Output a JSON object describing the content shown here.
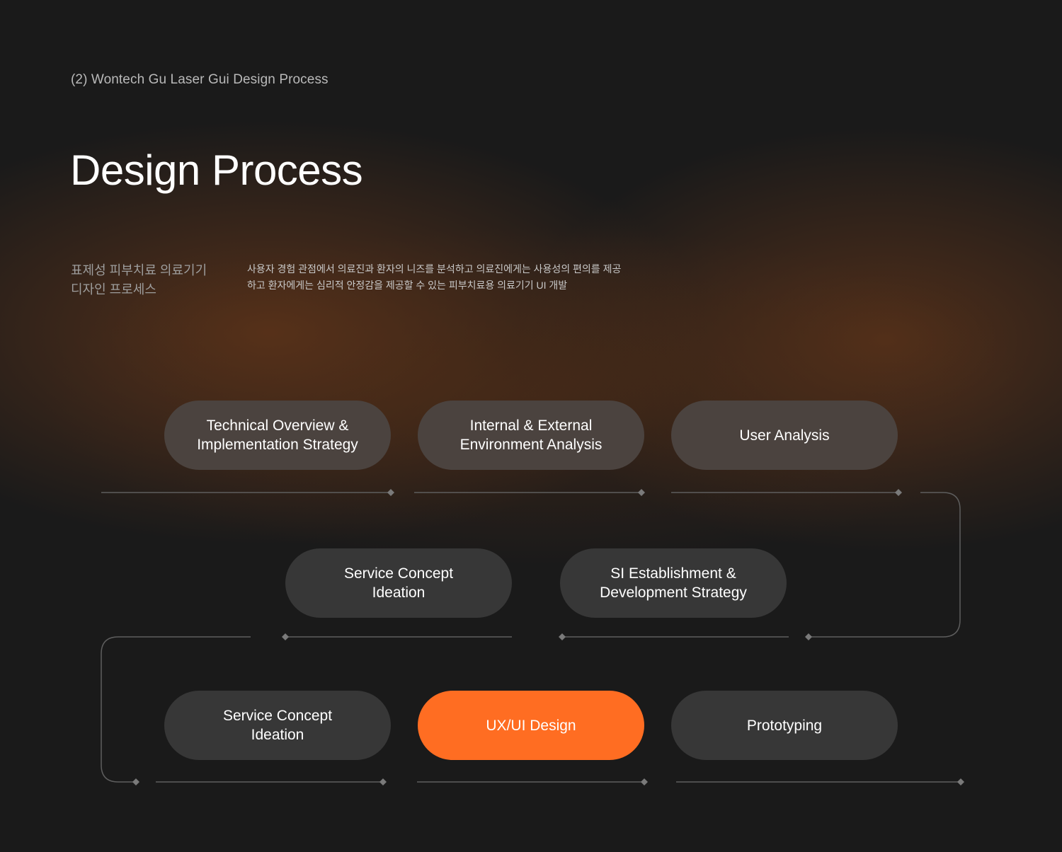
{
  "header": {
    "eyebrow": "(2) Wontech Gu Laser Gui Design Process",
    "title": "Design Process"
  },
  "intro": {
    "subtitle_lines": [
      "표제성 피부치료 의료기기",
      "디자인 프로세스"
    ],
    "description_lines": [
      "사용자 경험 관점에서 의료진과 환자의 니즈를 분석하고 의료진에게는 사용성의 편의를 제공",
      "하고 환자에게는 심리적 안정감을 제공할 수 있는 피부치료용 의료기기 UI 개발"
    ]
  },
  "colors": {
    "background": "#1a1a1a",
    "accent": "#ff6d22",
    "step_row_1": "#4b433f",
    "step_default": "#373737",
    "connector": "#5e5e5e"
  },
  "process": {
    "row1": [
      {
        "label": "Technical Overview &\nImplementation Strategy"
      },
      {
        "label": "Internal & External\nEnvironment Analysis"
      },
      {
        "label": "User Analysis"
      }
    ],
    "row2": [
      {
        "label": "Service Concept\nIdeation"
      },
      {
        "label": "SI Establishment &\nDevelopment Strategy"
      }
    ],
    "row3": [
      {
        "label": "Service Concept\nIdeation"
      },
      {
        "label": "UX/UI Design",
        "active": true
      },
      {
        "label": "Prototyping"
      }
    ]
  }
}
